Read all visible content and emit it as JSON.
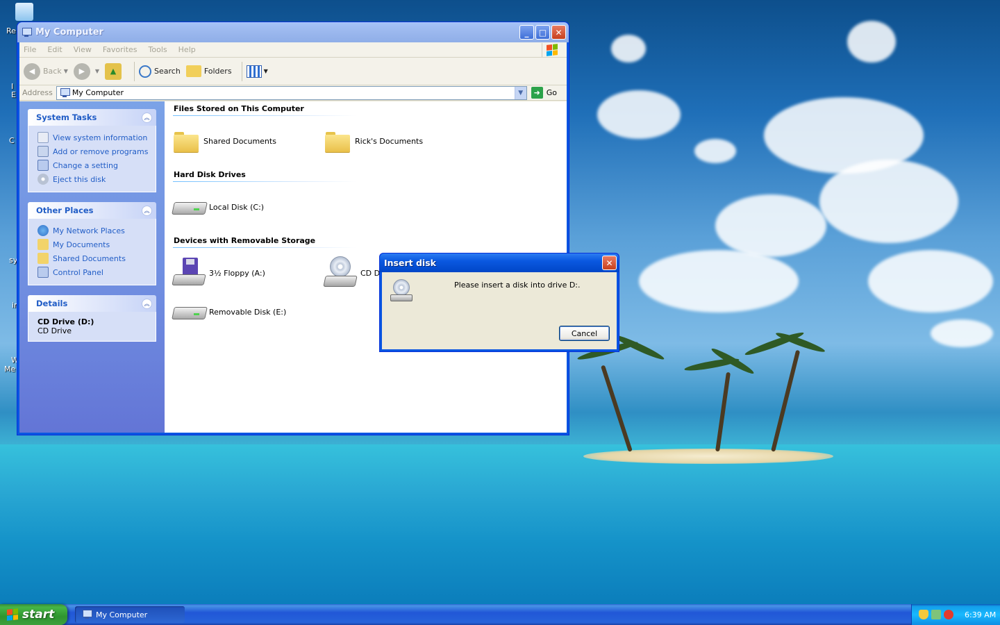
{
  "desktop": {
    "icon_label_fragments": [
      "Re",
      "I",
      "E",
      "C",
      "sy",
      "ir",
      "W",
      "Me"
    ]
  },
  "window": {
    "title": "My Computer",
    "title_buttons": {
      "minimize": "_",
      "maximize": "□",
      "close": "✕"
    },
    "menu": [
      "File",
      "Edit",
      "View",
      "Favorites",
      "Tools",
      "Help"
    ],
    "toolbar": {
      "back": "Back",
      "search": "Search",
      "folders": "Folders"
    },
    "address": {
      "label": "Address",
      "value": "My Computer",
      "go": "Go"
    },
    "sidebar": {
      "system_tasks": {
        "title": "System Tasks",
        "items": [
          "View system information",
          "Add or remove programs",
          "Change a setting",
          "Eject this disk"
        ]
      },
      "other_places": {
        "title": "Other Places",
        "items": [
          "My Network Places",
          "My Documents",
          "Shared Documents",
          "Control Panel"
        ]
      },
      "details": {
        "title": "Details",
        "name": "CD Drive (D:)",
        "type": "CD Drive"
      }
    },
    "groups": {
      "files": {
        "title": "Files Stored on This Computer",
        "items": [
          "Shared Documents",
          "Rick's Documents"
        ]
      },
      "hard_disks": {
        "title": "Hard Disk Drives",
        "items": [
          "Local Disk (C:)"
        ]
      },
      "removable": {
        "title": "Devices with Removable Storage",
        "items": [
          "3½ Floppy (A:)",
          "CD D",
          "Removable Disk (E:)"
        ]
      }
    }
  },
  "dialog": {
    "title": "Insert disk",
    "message": "Please insert a disk into drive D:.",
    "cancel": "Cancel",
    "close": "✕"
  },
  "taskbar": {
    "start": "start",
    "task": "My Computer",
    "clock": "6:39 AM"
  },
  "colors": {
    "title_inactive": "#9db9ef",
    "title_active": "#0a58e0",
    "sidebar_link": "#215dc6",
    "start_green": "#3da03d"
  }
}
